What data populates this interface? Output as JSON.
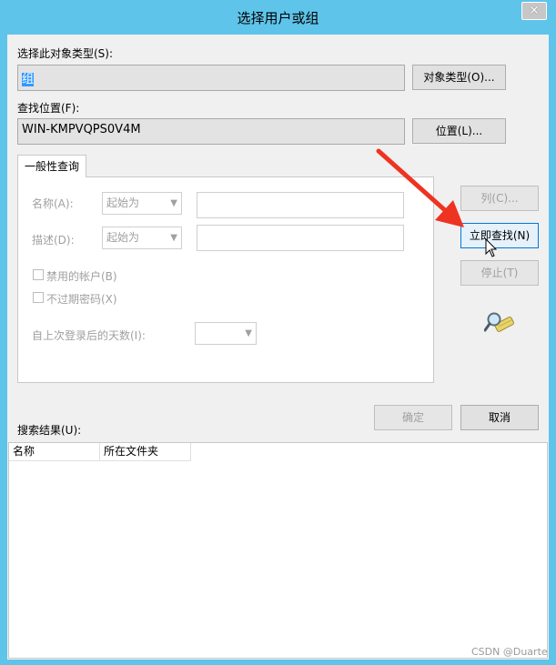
{
  "window": {
    "title": "选择用户或组",
    "close_glyph": "✕"
  },
  "object_type": {
    "label": "选择此对象类型(S):",
    "value": "组",
    "button": "对象类型(O)..."
  },
  "location": {
    "label": "查找位置(F):",
    "value": "WIN-KMPVQPS0V4M",
    "button": "位置(L)..."
  },
  "query": {
    "tab_label": "一般性查询",
    "name_label": "名称(A):",
    "name_mode": "起始为",
    "desc_label": "描述(D):",
    "desc_mode": "起始为",
    "disabled_accounts": "禁用的帐户(B)",
    "no_expire_password": "不过期密码(X)",
    "days_since_login": "自上次登录后的天数(I):"
  },
  "side_buttons": {
    "columns": "列(C)...",
    "find_now": "立即查找(N)",
    "stop": "停止(T)"
  },
  "dialog_buttons": {
    "ok": "确定",
    "cancel": "取消"
  },
  "results": {
    "label": "搜索结果(U):",
    "columns": [
      "名称",
      "所在文件夹"
    ]
  },
  "watermark": "CSDN @Duarte",
  "icons": {
    "search": "search-icon",
    "arrow": "red-arrow-annotation",
    "cursor": "mouse-cursor-icon"
  },
  "colors": {
    "titlebar": "#5ec4ea",
    "accent": "#0078d7",
    "annotation": "#ee3322"
  }
}
